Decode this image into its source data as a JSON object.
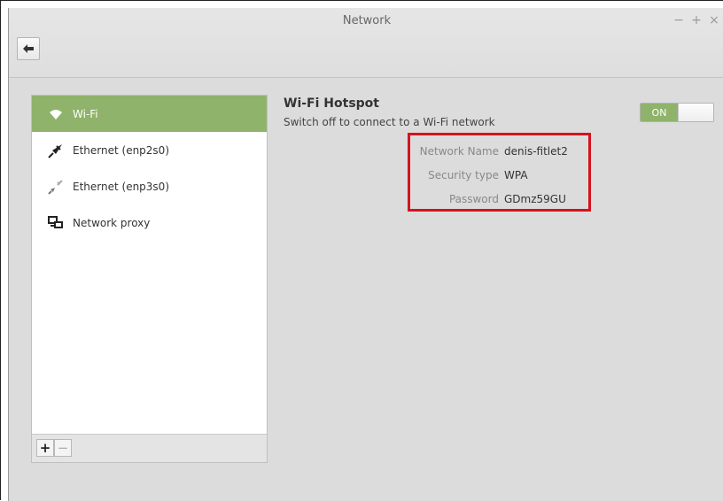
{
  "window": {
    "title": "Network",
    "controls": {
      "minimize": "−",
      "maximize": "+",
      "close": "×"
    }
  },
  "toolbar": {
    "back_icon": "back-arrow-icon"
  },
  "sidebar": {
    "items": [
      {
        "label": "Wi-Fi",
        "icon": "wifi-icon",
        "active": true
      },
      {
        "label": "Ethernet (enp2s0)",
        "icon": "ethernet-plug-connected-icon",
        "active": false
      },
      {
        "label": "Ethernet (enp3s0)",
        "icon": "ethernet-plug-disconnected-icon",
        "active": false
      },
      {
        "label": "Network proxy",
        "icon": "network-proxy-icon",
        "active": false
      }
    ],
    "add_label": "+",
    "remove_label": "−"
  },
  "hotspot": {
    "title": "Wi-Fi Hotspot",
    "subtitle": "Switch off to connect to a Wi-Fi network",
    "toggle_label": "ON",
    "toggle_state": true,
    "fields": [
      {
        "label": "Network Name",
        "value": "denis-fitlet2"
      },
      {
        "label": "Security type",
        "value": "WPA"
      },
      {
        "label": "Password",
        "value": "GDmz59GU"
      }
    ]
  },
  "colors": {
    "accent": "#8fb36a",
    "highlight_box": "#d4121f",
    "window_bg": "#dcdcdc"
  }
}
